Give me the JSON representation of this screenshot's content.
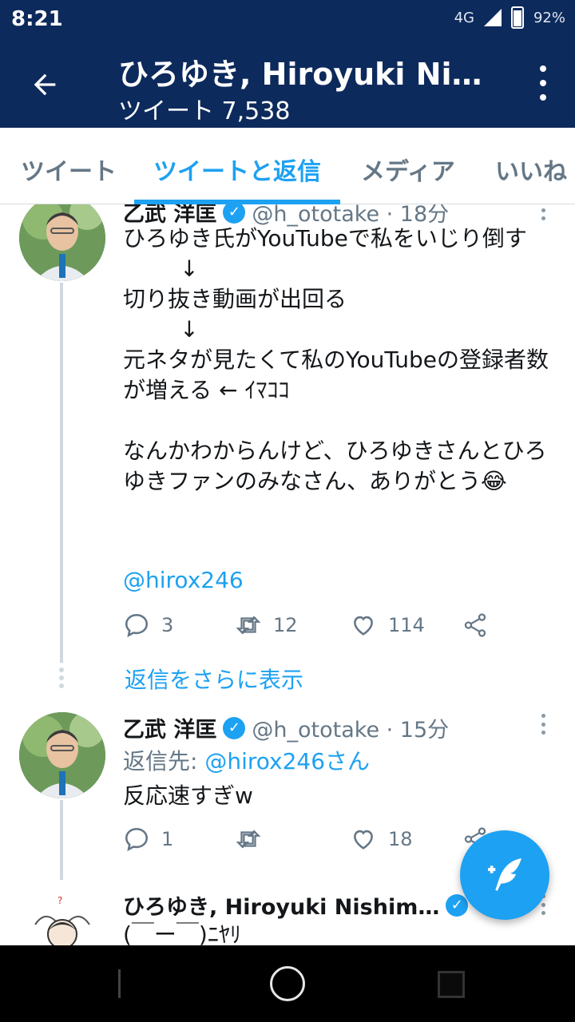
{
  "status_bar": {
    "time": "8:21",
    "network": "4G",
    "battery": "92%"
  },
  "header": {
    "title": "ひろゆき, Hiroyuki Nis…",
    "subtitle": "ツイート 7,538"
  },
  "tabs": [
    {
      "label": "ツイート",
      "active": false
    },
    {
      "label": "ツイートと返信",
      "active": true
    },
    {
      "label": "メディア",
      "active": false
    },
    {
      "label": "いいね",
      "active": false
    }
  ],
  "tweets": [
    {
      "name": "乙武 洋匡",
      "handle": "@h_ototake · 18分",
      "text": "ひろゆき氏がYouTubeで私をいじり倒す\n        ↓\n切り抜き動画が出回る\n        ↓\n元ネタが見たくて私のYouTubeの登録者数が増える ← ｲﾏｺｺ\n\nなんかわからんけど、ひろゆきさんとひろゆきファンのみなさん、ありがとう😂",
      "mention": "@hirox246",
      "replies": "3",
      "retweets": "12",
      "likes": "114"
    },
    {
      "name": "乙武 洋匡",
      "handle": "@h_ototake · 15分",
      "reply_to_label": "返信先:",
      "reply_to_user": "@hirox246さん",
      "text": "反応速すぎw",
      "replies": "1",
      "retweets": "",
      "likes": "18"
    },
    {
      "name": "ひろゆき, Hiroyuki Nishim…",
      "text": "(￣ー￣)ﾆﾔﾘ"
    }
  ],
  "more_replies": "返信をさらに表示",
  "colors": {
    "header_bg": "#0d2a5c",
    "accent": "#1da1f2",
    "muted": "#657786"
  }
}
